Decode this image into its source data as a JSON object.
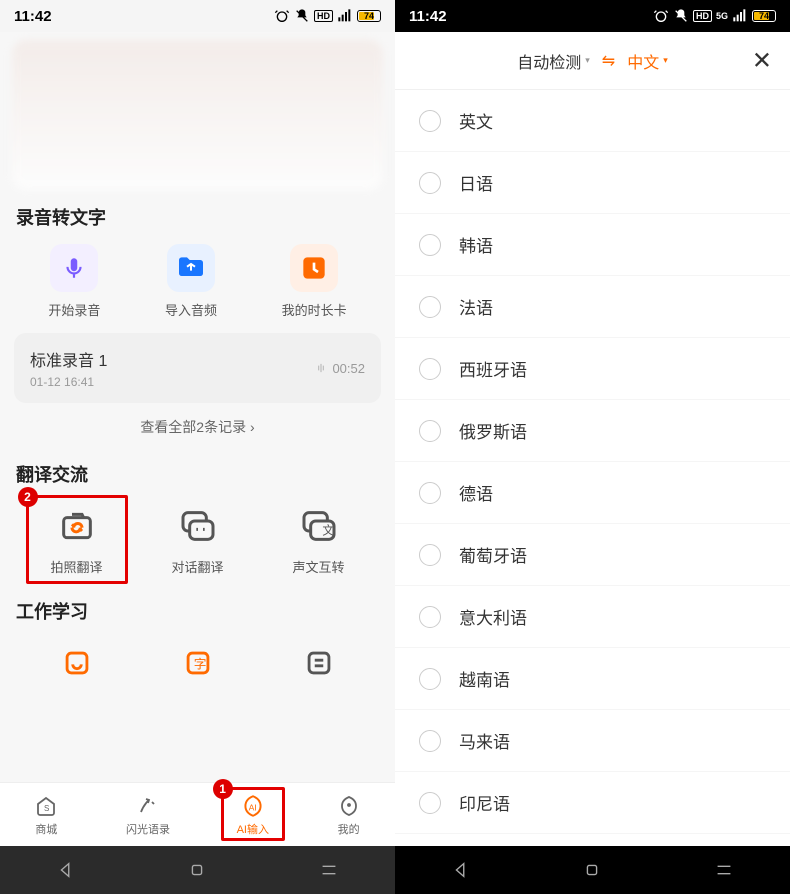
{
  "status": {
    "time": "11:42",
    "battery_pct": "74"
  },
  "left": {
    "sections": {
      "recording_title": "录音转文字",
      "translate_title": "翻译交流",
      "work_title": "工作学习"
    },
    "rec_tiles": [
      {
        "label": "开始录音",
        "icon": "mic-icon",
        "color": "#7a5cff"
      },
      {
        "label": "导入音频",
        "icon": "folder-icon",
        "color": "#1976ff"
      },
      {
        "label": "我的时长卡",
        "icon": "clock-icon",
        "color": "#ff6a00"
      }
    ],
    "recording": {
      "title": "标准录音 1",
      "duration": "00:52",
      "timestamp": "01-12 16:41"
    },
    "see_all": "查看全部2条记录",
    "translate_tiles": [
      {
        "label": "拍照翻译",
        "icon": "camera-swap-icon"
      },
      {
        "label": "对话翻译",
        "icon": "chat-icon"
      },
      {
        "label": "声文互转",
        "icon": "voice-text-icon"
      }
    ],
    "nav": [
      {
        "label": "商城",
        "icon": "shop-icon",
        "active": false
      },
      {
        "label": "闪光语录",
        "icon": "quote-icon",
        "active": false
      },
      {
        "label": "AI输入",
        "icon": "ai-icon",
        "active": true
      },
      {
        "label": "我的",
        "icon": "me-icon",
        "active": false
      }
    ],
    "badges": {
      "one": "1",
      "two": "2"
    }
  },
  "right": {
    "source": "自动检测",
    "target": "中文",
    "languages": [
      "英文",
      "日语",
      "韩语",
      "法语",
      "西班牙语",
      "俄罗斯语",
      "德语",
      "葡萄牙语",
      "意大利语",
      "越南语",
      "马来语",
      "印尼语"
    ]
  }
}
